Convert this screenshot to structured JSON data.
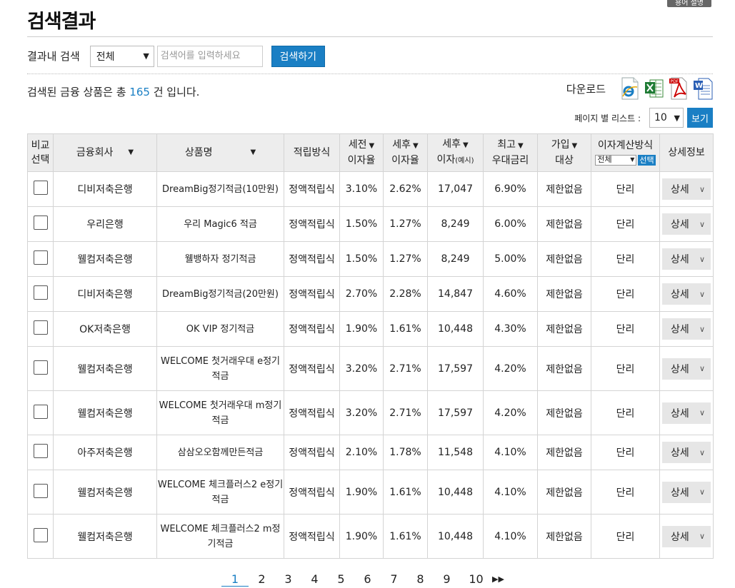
{
  "top_badge": "용어 설명",
  "title": "검색결과",
  "search": {
    "label": "결과내 검색",
    "select_value": "전체",
    "placeholder": "검색어를 입력하세요",
    "button": "검색하기"
  },
  "summary": {
    "prefix": "검색된 금융 상품은 총",
    "count": "165",
    "suffix": "건 입니다."
  },
  "download": {
    "label": "다운로드",
    "icons": [
      "ie-icon",
      "excel-icon",
      "pdf-icon",
      "word-icon"
    ]
  },
  "per_page": {
    "label": "페이지 별 리스트 :",
    "value": "10",
    "button": "보기"
  },
  "table": {
    "headers": {
      "compare_1": "비교",
      "compare_2": "선택",
      "company": "금융회사",
      "product": "상품명",
      "method": "적립방식",
      "pretax_1": "세전",
      "pretax_2": "이자율",
      "posttax_1": "세후",
      "posttax_2": "이자율",
      "interest_1": "세후",
      "interest_2": "이자",
      "interest_3": "(예시)",
      "max_1": "최고",
      "max_2": "우대금리",
      "target_1": "가입",
      "target_2": "대상",
      "calc": "이자계산방식",
      "calc_select": "전체",
      "calc_btn": "선택",
      "detail": "상세정보"
    },
    "rows": [
      {
        "company": "디비저축은행",
        "product": "DreamBig정기적금(10만원)",
        "method": "정액적립식",
        "pretax": "3.10%",
        "posttax": "2.62%",
        "interest": "17,047",
        "max": "6.90%",
        "target": "제한없음",
        "calc": "단리",
        "detail": "상세"
      },
      {
        "company": "우리은행",
        "product": "우리 Magic6 적금",
        "method": "정액적립식",
        "pretax": "1.50%",
        "posttax": "1.27%",
        "interest": "8,249",
        "max": "6.00%",
        "target": "제한없음",
        "calc": "단리",
        "detail": "상세"
      },
      {
        "company": "웰컴저축은행",
        "product": "웰뱅하자 정기적금",
        "method": "정액적립식",
        "pretax": "1.50%",
        "posttax": "1.27%",
        "interest": "8,249",
        "max": "5.00%",
        "target": "제한없음",
        "calc": "단리",
        "detail": "상세"
      },
      {
        "company": "디비저축은행",
        "product": "DreamBig정기적금(20만원)",
        "method": "정액적립식",
        "pretax": "2.70%",
        "posttax": "2.28%",
        "interest": "14,847",
        "max": "4.60%",
        "target": "제한없음",
        "calc": "단리",
        "detail": "상세"
      },
      {
        "company": "OK저축은행",
        "product": "OK VIP 정기적금",
        "method": "정액적립식",
        "pretax": "1.90%",
        "posttax": "1.61%",
        "interest": "10,448",
        "max": "4.30%",
        "target": "제한없음",
        "calc": "단리",
        "detail": "상세"
      },
      {
        "company": "웰컴저축은행",
        "product": "WELCOME 첫거래우대 e정기적금",
        "method": "정액적립식",
        "pretax": "3.20%",
        "posttax": "2.71%",
        "interest": "17,597",
        "max": "4.20%",
        "target": "제한없음",
        "calc": "단리",
        "detail": "상세"
      },
      {
        "company": "웰컴저축은행",
        "product": "WELCOME 첫거래우대 m정기적금",
        "method": "정액적립식",
        "pretax": "3.20%",
        "posttax": "2.71%",
        "interest": "17,597",
        "max": "4.20%",
        "target": "제한없음",
        "calc": "단리",
        "detail": "상세"
      },
      {
        "company": "아주저축은행",
        "product": "삼삼오오함께만든적금",
        "method": "정액적립식",
        "pretax": "2.10%",
        "posttax": "1.78%",
        "interest": "11,548",
        "max": "4.10%",
        "target": "제한없음",
        "calc": "단리",
        "detail": "상세"
      },
      {
        "company": "웰컴저축은행",
        "product": "WELCOME 체크플러스2 e정기적금",
        "method": "정액적립식",
        "pretax": "1.90%",
        "posttax": "1.61%",
        "interest": "10,448",
        "max": "4.10%",
        "target": "제한없음",
        "calc": "단리",
        "detail": "상세"
      },
      {
        "company": "웰컴저축은행",
        "product": "WELCOME 체크플러스2 m정기적금",
        "method": "정액적립식",
        "pretax": "1.90%",
        "posttax": "1.61%",
        "interest": "10,448",
        "max": "4.10%",
        "target": "제한없음",
        "calc": "단리",
        "detail": "상세"
      }
    ]
  },
  "pagination": {
    "pages": [
      "1",
      "2",
      "3",
      "4",
      "5",
      "6",
      "7",
      "8",
      "9",
      "10"
    ],
    "current": "1",
    "next": "▶▶"
  }
}
